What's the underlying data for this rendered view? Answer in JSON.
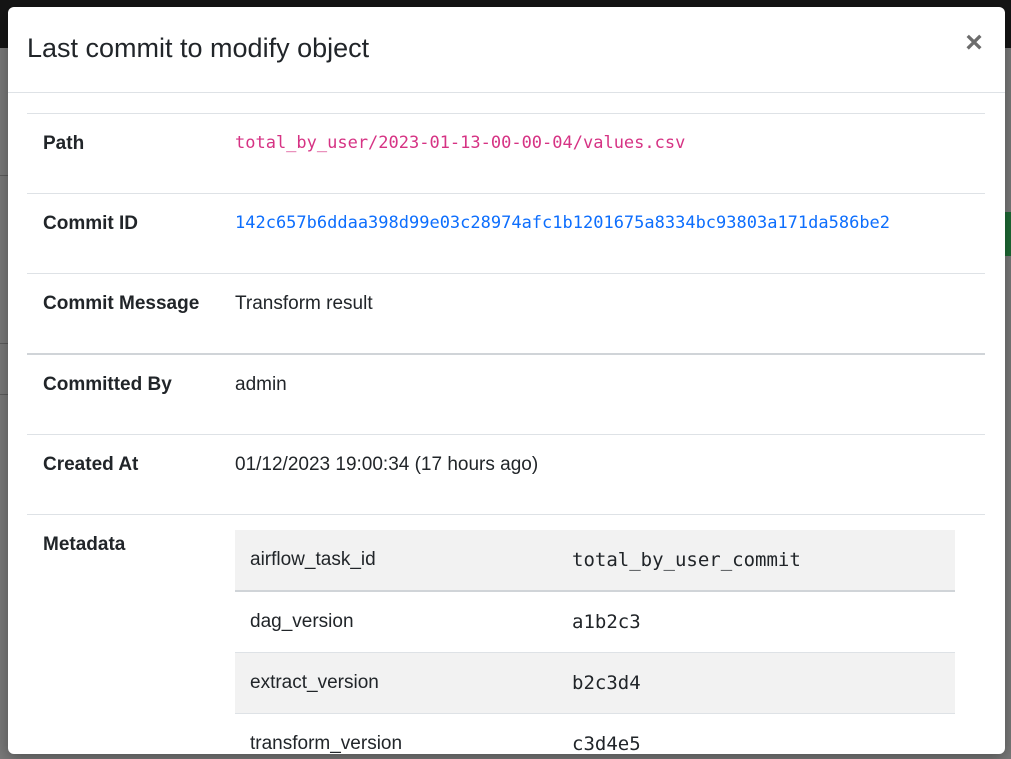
{
  "modal": {
    "title": "Last commit to modify object",
    "close_label": "×"
  },
  "details": {
    "path_label": "Path",
    "path_value": "total_by_user/2023-01-13-00-00-04/values.csv",
    "commit_id_label": "Commit ID",
    "commit_id_value": "142c657b6ddaa398d99e03c28974afc1b1201675a8334bc93803a171da586be2",
    "message_label": "Commit Message",
    "message_value": "Transform result",
    "committed_by_label": "Committed By",
    "committed_by_value": "admin",
    "created_at_label": "Created At",
    "created_at_value": "01/12/2023 19:00:34 (17 hours ago)",
    "metadata_label": "Metadata"
  },
  "metadata": [
    {
      "key": "airflow_task_id",
      "value": "total_by_user_commit"
    },
    {
      "key": "dag_version",
      "value": "a1b2c3"
    },
    {
      "key": "extract_version",
      "value": "b2c3d4"
    },
    {
      "key": "transform_version",
      "value": "c3d4e5"
    }
  ],
  "colors": {
    "code_pink": "#d63384",
    "link_blue": "#0d6efd",
    "stripe": "#f2f2f2"
  }
}
